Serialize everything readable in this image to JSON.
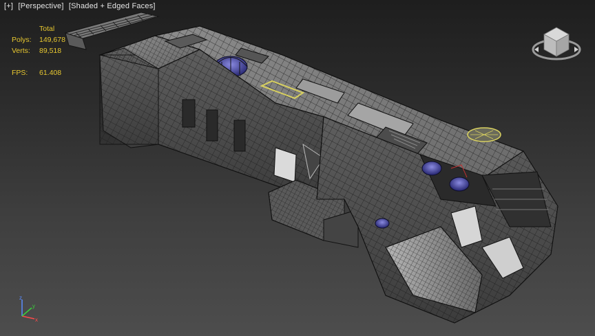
{
  "viewport": {
    "label": {
      "plus": "[+]",
      "view": "[Perspective]",
      "shading": "[Shaded + Edged Faces]"
    },
    "stats": {
      "total_header": "Total",
      "polys_label": "Polys:",
      "polys_value": "149,678",
      "verts_label": "Verts:",
      "verts_value": "89,518",
      "fps_label": "FPS:",
      "fps_value": "61.408"
    },
    "colors": {
      "stats_text": "#e8c830",
      "label_text": "#e6e6e6",
      "wire": "#111111",
      "hull_light": "#9a9a9a",
      "hull_mid": "#6e6e6e",
      "hull_dark": "#4a4a4a",
      "selection_yellow": "#d8d060",
      "dome_blue": "#3b3bb0"
    },
    "icons": {
      "viewcube": "viewcube-icon",
      "axis": "axis-tripod-icon"
    }
  }
}
